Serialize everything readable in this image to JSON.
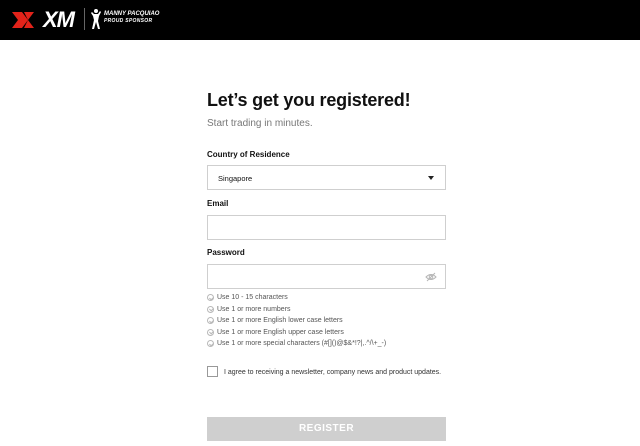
{
  "header": {
    "logo_text": "XM",
    "sponsor_line1": "MANNY PACQUIAO",
    "sponsor_line2": "PROUD SPONSOR",
    "colors": {
      "background": "#000000",
      "logo_accent": "#e2231a"
    }
  },
  "form": {
    "title": "Let’s get you registered!",
    "subtitle": "Start trading in minutes.",
    "country": {
      "label": "Country of Residence",
      "value": "Singapore"
    },
    "email": {
      "label": "Email",
      "value": "",
      "placeholder": ""
    },
    "password": {
      "label": "Password",
      "value": "",
      "placeholder": "",
      "icon": "eye-slash-icon"
    },
    "rules": [
      "Use 10 - 15 characters",
      "Use 1 or more numbers",
      "Use 1 or more English lower case letters",
      "Use 1 or more English upper case letters",
      "Use 1 or more special characters (#[]()@$&*!?|,.^/\\+_-)"
    ],
    "newsletter": {
      "label": "I agree to receiving a newsletter, company news and product updates.",
      "checked": false
    },
    "register_label": "REGISTER",
    "colors": {
      "button_disabled": "#cfcfcf",
      "field_border": "#cfcfcf"
    }
  }
}
